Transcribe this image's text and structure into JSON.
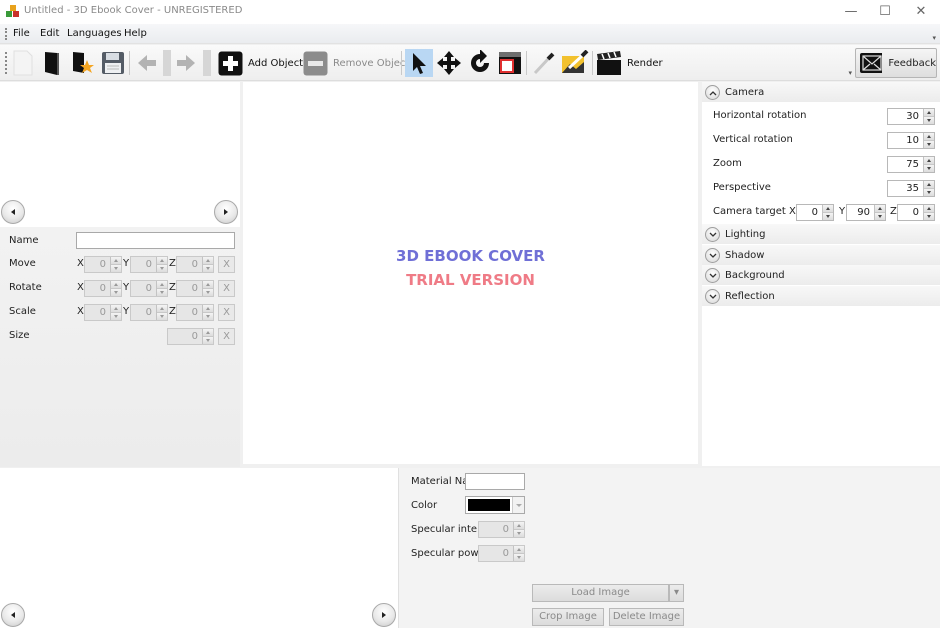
{
  "window": {
    "title": "Untitled - 3D Ebook Cover - UNREGISTERED",
    "minimize": "—",
    "maximize": "☐",
    "close": "✕"
  },
  "menu": {
    "items": [
      "File",
      "Edit",
      "Languages",
      "Help"
    ]
  },
  "toolbar": {
    "new_icon": "new-document-icon",
    "open_icon": "open-book-icon",
    "favorite_icon": "favorite-book-icon",
    "save_icon": "save-disk-icon",
    "undo_icon": "arrow-left-icon",
    "redo_icon": "arrow-right-icon",
    "add_object": "Add Object",
    "remove_object": "Remove Object",
    "select_tool": "pointer-icon",
    "move_tool": "move-icon",
    "rotate_tool": "rotate-icon",
    "crop_tool": "frame-icon",
    "picker_tool": "eyedropper-icon",
    "picker2_tool": "eyedropper-image-icon",
    "render": "Render",
    "feedback": "Feedback"
  },
  "object_props": {
    "name_label": "Name",
    "name_value": "",
    "rows": [
      {
        "label": "Move",
        "x": "0",
        "y": "0",
        "z": "0"
      },
      {
        "label": "Rotate",
        "x": "0",
        "y": "0",
        "z": "0"
      },
      {
        "label": "Scale",
        "x": "0",
        "y": "0",
        "z": "0"
      }
    ],
    "size_label": "Size",
    "size_value": "0",
    "axis_x": "X",
    "axis_y": "Y",
    "axis_z": "Z",
    "reset": "X"
  },
  "viewport": {
    "watermark_line1": "3D EBOOK COVER",
    "watermark_line2": "TRIAL VERSION",
    "watermark_color1": "#6f6fd6",
    "watermark_color2": "#ef7b86"
  },
  "camera": {
    "header": "Camera",
    "horizontal_rotation_label": "Horizontal rotation",
    "horizontal_rotation": "30",
    "vertical_rotation_label": "Vertical rotation",
    "vertical_rotation": "10",
    "zoom_label": "Zoom",
    "zoom": "75",
    "perspective_label": "Perspective",
    "perspective": "35",
    "target_label": "Camera target",
    "target_x": "0",
    "target_y": "90",
    "target_z": "0"
  },
  "sections": [
    "Lighting",
    "Shadow",
    "Background",
    "Reflection"
  ],
  "material": {
    "name_label": "Material Na",
    "name_value": "",
    "color_label": "Color",
    "color_value": "#000000",
    "spec_intensity_label": "Specular inten",
    "spec_intensity": "0",
    "spec_power_label": "Specular powe",
    "spec_power": "0",
    "load_image": "Load Image",
    "crop_image": "Crop Image",
    "delete_image": "Delete Image"
  }
}
